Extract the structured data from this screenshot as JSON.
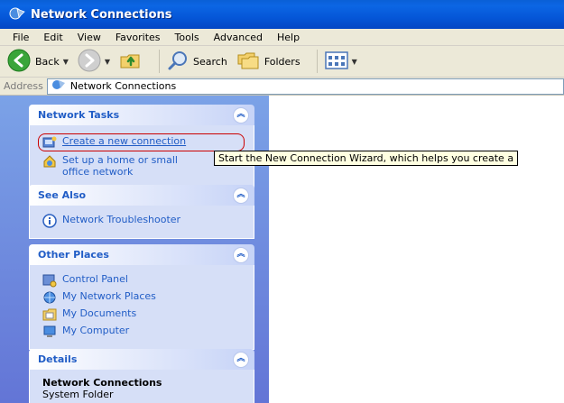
{
  "window": {
    "title": "Network Connections"
  },
  "menubar": {
    "items": [
      "File",
      "Edit",
      "View",
      "Favorites",
      "Tools",
      "Advanced",
      "Help"
    ]
  },
  "toolbar": {
    "back_label": "Back",
    "search_label": "Search",
    "folders_label": "Folders"
  },
  "address": {
    "label": "Address",
    "value": "Network Connections"
  },
  "taskpane": {
    "network_tasks": {
      "title": "Network Tasks",
      "items": [
        "Create a new connection",
        "Set up a home or small office network"
      ]
    },
    "see_also": {
      "title": "See Also",
      "items": [
        "Network Troubleshooter"
      ]
    },
    "other_places": {
      "title": "Other Places",
      "items": [
        "Control Panel",
        "My Network Places",
        "My Documents",
        "My Computer"
      ]
    },
    "details": {
      "title": "Details",
      "name": "Network Connections",
      "type": "System Folder"
    }
  },
  "tooltip": {
    "text": "Start the New Connection Wizard, which helps you create a"
  },
  "colors": {
    "title_bar": "#0557d8",
    "task_pane": "#6375d6",
    "link": "#215dc6",
    "highlight_ring": "#cc0000"
  }
}
